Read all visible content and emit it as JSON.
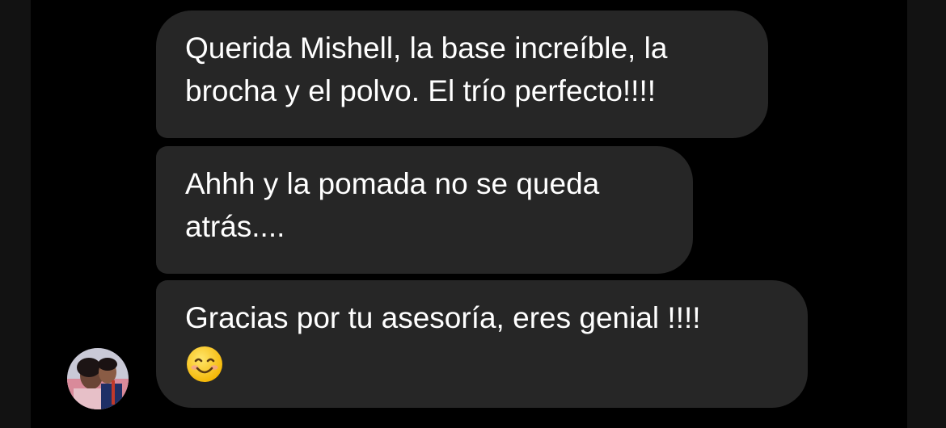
{
  "conversation": {
    "messages": [
      {
        "lines": [
          "Querida Mishell, la base increíble, la",
          "brocha y el polvo. El trío perfecto!!!!"
        ]
      },
      {
        "lines": [
          "Ahhh y la pomada no se queda",
          "atrás...."
        ]
      },
      {
        "lines": [
          "Gracias por tu asesoría, eres genial !!!!"
        ],
        "emoji": "smiling-face-emoji"
      }
    ],
    "sender_avatar": "avatar-icon"
  },
  "colors": {
    "background": "#000000",
    "bubble": "#262626",
    "text": "#ffffff",
    "side_panels": "#121212"
  }
}
